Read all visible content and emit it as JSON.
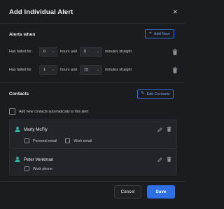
{
  "dialog": {
    "title": "Add Individual Alert"
  },
  "alerts": {
    "section_title": "Alerts when",
    "add_button_label": "Add New",
    "rules": [
      {
        "prefix": "Has failed for",
        "hours": "0",
        "hours_label": "hours and",
        "minutes": "0",
        "minutes_label": "minutes straight"
      },
      {
        "prefix": "Has failed for",
        "hours": "1",
        "hours_label": "hours and",
        "minutes": "15",
        "minutes_label": "minutes straight"
      }
    ]
  },
  "contacts": {
    "section_title": "Contacts",
    "edit_button_label": "Edit Contacts",
    "auto_add_label": "Add new contacts automatically to this alert",
    "people": [
      {
        "name": "Marty McFly",
        "options": [
          "Personal email",
          "Work email"
        ]
      },
      {
        "name": "Peter Venkman",
        "options": [
          "Work phone"
        ]
      }
    ]
  },
  "footer": {
    "cancel_label": "Cancel",
    "save_label": "Save"
  },
  "colors": {
    "accent": "#2f6fe4",
    "background": "#1b1c20",
    "card": "#232429",
    "person_icon": "#2bb5a3"
  }
}
